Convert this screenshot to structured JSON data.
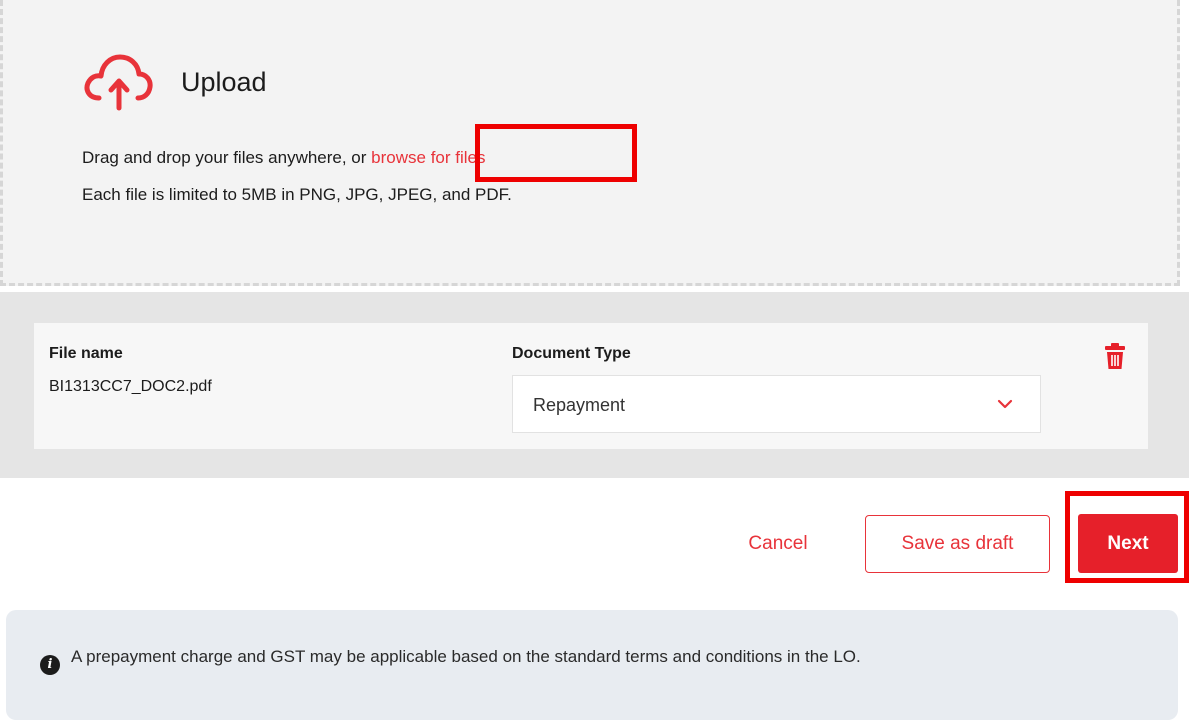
{
  "upload": {
    "title": "Upload",
    "instruction": "Drag and drop your files anywhere, or",
    "browse_link": "browse for files",
    "limits": "Each file is limited to 5MB in PNG, JPG, JPEG, and PDF.",
    "icon": "cloud-upload-icon"
  },
  "file_list": {
    "file_name_header": "File name",
    "document_type_header": "Document Type",
    "rows": [
      {
        "file_name": "BI1313CC7_DOC2.pdf",
        "document_type": "Repayment"
      }
    ]
  },
  "actions": {
    "cancel": "Cancel",
    "save_draft": "Save as draft",
    "next": "Next"
  },
  "notice": {
    "icon": "info-icon",
    "text": "A prepayment charge and GST may be applicable based on the standard terms and conditions in the LO."
  },
  "colors": {
    "accent": "#e8333a",
    "primary_button": "#e6202a",
    "highlight": "#ee0000"
  }
}
